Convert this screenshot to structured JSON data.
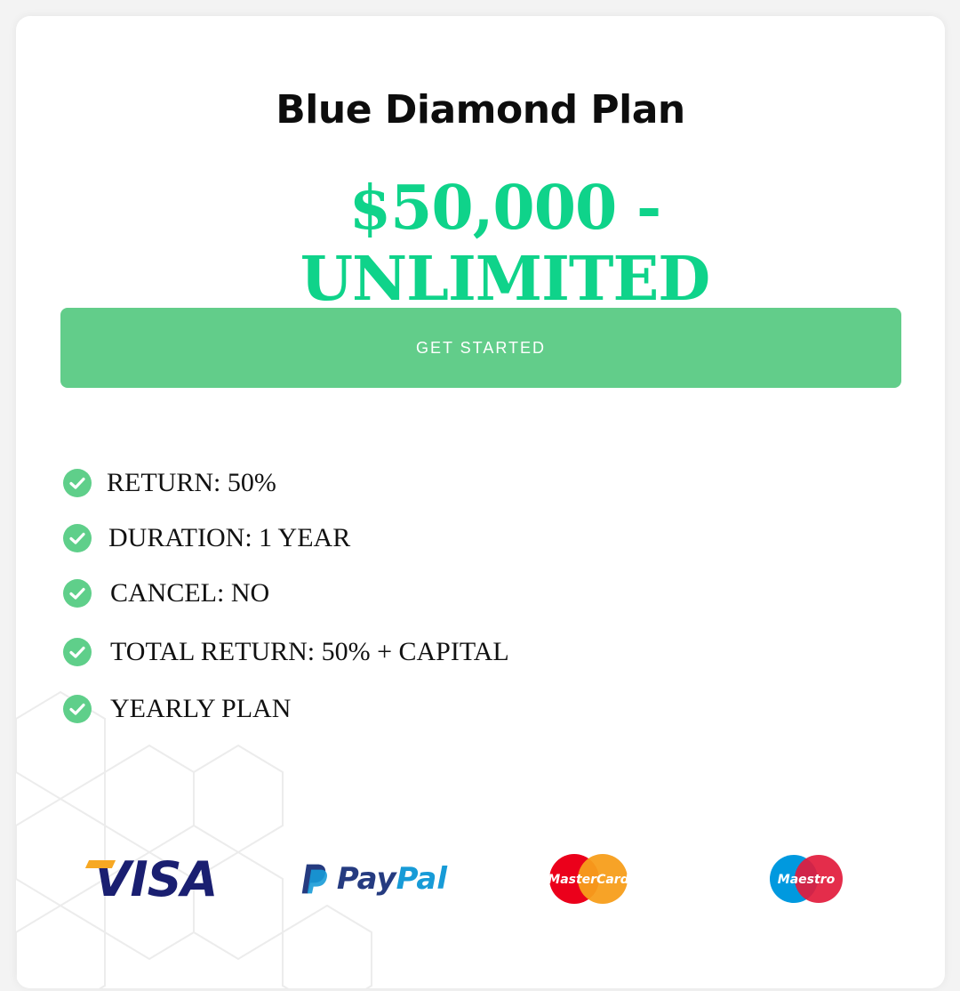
{
  "plan": {
    "title": "Blue Diamond Plan",
    "price": "$50,000 - UNLIMITED",
    "cta_label": "GET STARTED"
  },
  "features": [
    {
      "label": "RETURN: 50%",
      "icon": "check-circle-icon"
    },
    {
      "label": "DURATION: 1 YEAR",
      "icon": "check-circle-icon"
    },
    {
      "label": "CANCEL: NO",
      "icon": "check-circle-icon"
    },
    {
      "label": "TOTAL RETURN: 50% + CAPITAL",
      "icon": "check-circle-icon"
    },
    {
      "label": "YEARLY PLAN",
      "icon": "check-circle-icon"
    }
  ],
  "payments": {
    "visa": "VISA",
    "paypal_pay": "Pay",
    "paypal_pal": "Pal",
    "mastercard": "MasterCard",
    "maestro": "Maestro"
  },
  "colors": {
    "price": "#0fd38a",
    "button": "#62cd8a",
    "check": "#5fcf8a",
    "text": "#111111"
  }
}
